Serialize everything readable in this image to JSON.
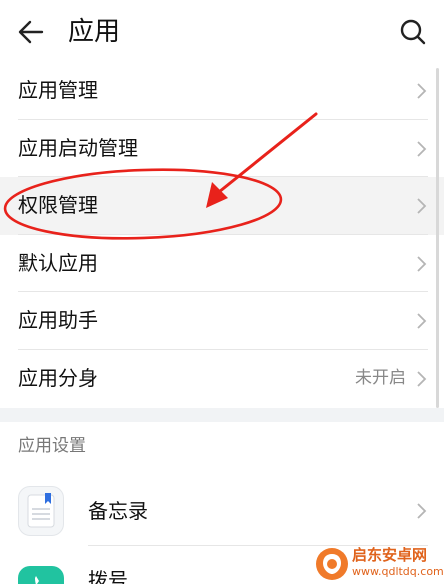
{
  "header": {
    "title": "应用",
    "back_icon": "arrow-left-icon",
    "search_icon": "search-icon"
  },
  "menu": {
    "items": [
      {
        "label": "应用管理",
        "value": ""
      },
      {
        "label": "应用启动管理",
        "value": ""
      },
      {
        "label": "权限管理",
        "value": ""
      },
      {
        "label": "默认应用",
        "value": ""
      },
      {
        "label": "应用助手",
        "value": ""
      },
      {
        "label": "应用分身",
        "value": "未开启"
      }
    ]
  },
  "settings": {
    "title": "应用设置",
    "apps": [
      {
        "label": "备忘录",
        "icon": "notepad-icon"
      },
      {
        "label": "拨号",
        "icon": "phone-icon"
      }
    ]
  },
  "annotation": {
    "color": "#e8221b"
  },
  "watermark": {
    "text": "启东安卓网",
    "url": "www.qdltdq.com"
  }
}
